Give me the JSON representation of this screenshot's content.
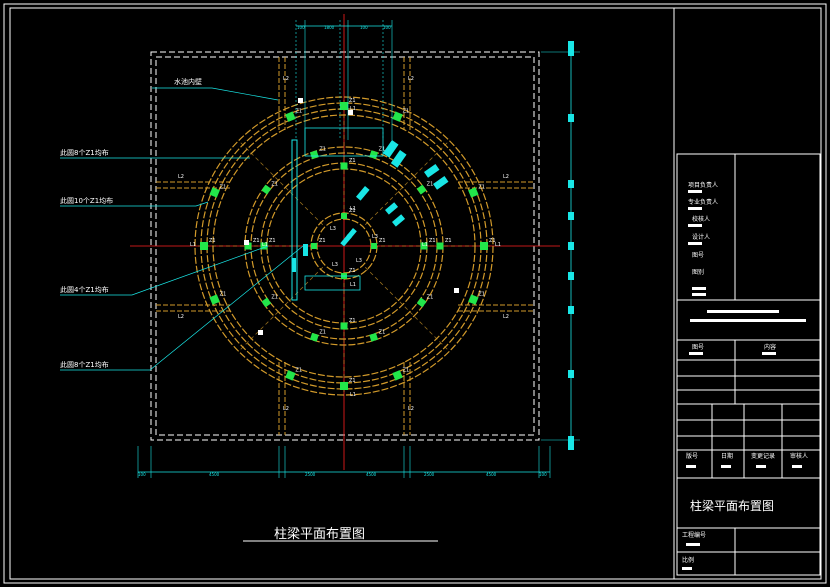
{
  "drawing": {
    "title": "柱梁平面布置图",
    "note_wall": "水池内壁",
    "callouts": [
      "此圆8个Z1均布",
      "此圆10个Z1均布",
      "此圆4个Z1均布",
      "此圆8个Z1均布"
    ],
    "column_tag": "Z1",
    "beam_tag": "L1",
    "beam_tag2": "L2",
    "beam_tag3": "L3",
    "dims_top": [
      "100",
      "1800",
      "100",
      "100"
    ],
    "dims_bottom": [
      "100",
      "4500",
      "2500",
      "4500",
      "2500",
      "4500",
      "100"
    ]
  },
  "title_block": {
    "rows": [
      "项目负责人",
      "专业负责人",
      "校核人",
      "设计人",
      "图号",
      "图别"
    ],
    "drawing_no_label": "图号",
    "content_label": "内容",
    "sign_labels": [
      "版号",
      "日期",
      "变更记录",
      "审核人"
    ],
    "drawing_name": "柱梁平面布置图",
    "project_no_label": "工程编号",
    "scale_label": "比例"
  },
  "colors": {
    "frame": "#ffffff",
    "beam": "#d29a2a",
    "column": "#22e64a",
    "axis": "#ff2020",
    "dim": "#19e6e6",
    "background": "#000000"
  }
}
